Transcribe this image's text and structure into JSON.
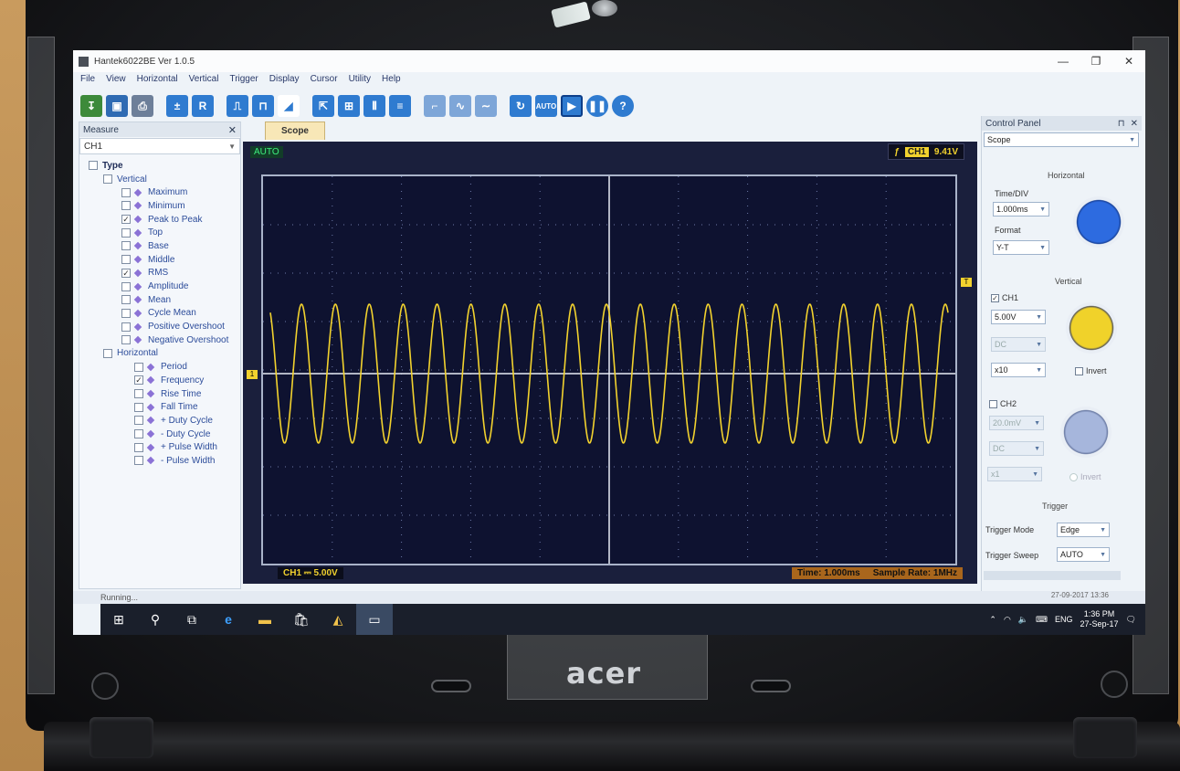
{
  "window": {
    "title": "Hantek6022BE Ver 1.0.5",
    "controls": [
      "—",
      "❐",
      "✕"
    ]
  },
  "menu": [
    "File",
    "View",
    "Horizontal",
    "Vertical",
    "Trigger",
    "Display",
    "Cursor",
    "Utility",
    "Help"
  ],
  "measure": {
    "title": "Measure",
    "close": "✕",
    "channel": "CH1",
    "root": "Type",
    "vertical_group": "Vertical",
    "vertical_items": [
      {
        "label": "Maximum",
        "checked": false
      },
      {
        "label": "Minimum",
        "checked": false
      },
      {
        "label": "Peak to Peak",
        "checked": true
      },
      {
        "label": "Top",
        "checked": false
      },
      {
        "label": "Base",
        "checked": false
      },
      {
        "label": "Middle",
        "checked": false
      },
      {
        "label": "RMS",
        "checked": true
      },
      {
        "label": "Amplitude",
        "checked": false
      },
      {
        "label": "Mean",
        "checked": false
      },
      {
        "label": "Cycle Mean",
        "checked": false
      },
      {
        "label": "Positive Overshoot",
        "checked": false
      },
      {
        "label": "Negative Overshoot",
        "checked": false
      }
    ],
    "horizontal_group": "Horizontal",
    "horizontal_items": [
      {
        "label": "Period",
        "checked": false
      },
      {
        "label": "Frequency",
        "checked": true
      },
      {
        "label": "Rise Time",
        "checked": false
      },
      {
        "label": "Fall Time",
        "checked": false
      },
      {
        "label": "+ Duty Cycle",
        "checked": false
      },
      {
        "label": "- Duty Cycle",
        "checked": false
      },
      {
        "label": "+ Pulse Width",
        "checked": false
      },
      {
        "label": "- Pulse Width",
        "checked": false
      }
    ]
  },
  "scope": {
    "tab": "Scope",
    "mode": "AUTO",
    "trigger_channel": "CH1",
    "trigger_level": "9.41V",
    "ch1_marker": "1",
    "trig_marker": "T",
    "ch1_scale": "CH1 ⎓  5.00V",
    "time_div": "Time: 1.000ms",
    "sample_rate": "Sample Rate: 1MHz",
    "cycles": 20,
    "trace_color": "#f2d22e"
  },
  "control_panel": {
    "title": "Control Panel",
    "pin": "⊓",
    "close": "✕",
    "mode": "Scope",
    "horizontal_title": "Horizontal",
    "timediv_label": "Time/DIV",
    "timediv_value": "1.000ms",
    "format_label": "Format",
    "format_value": "Y-T",
    "vertical_title": "Vertical",
    "ch1_label": "CH1",
    "ch1_volt": "5.00V",
    "ch1_coupling": "DC",
    "ch1_probe": "x10",
    "ch1_invert": "Invert",
    "ch2_label": "CH2",
    "ch2_volt": "20.0mV",
    "ch2_coupling": "DC",
    "ch2_probe": "x1",
    "ch2_invert": "Invert",
    "trigger_title": "Trigger",
    "trigger_mode_label": "Trigger Mode",
    "trigger_mode_value": "Edge",
    "trigger_sweep_label": "Trigger Sweep",
    "trigger_sweep_value": "AUTO"
  },
  "status": {
    "text": "Running...",
    "date": "27-09-2017  13:36"
  },
  "taskbar": {
    "time": "1:36 PM",
    "date": "27-Sep-17",
    "lang": "ENG"
  },
  "brand": "acer"
}
